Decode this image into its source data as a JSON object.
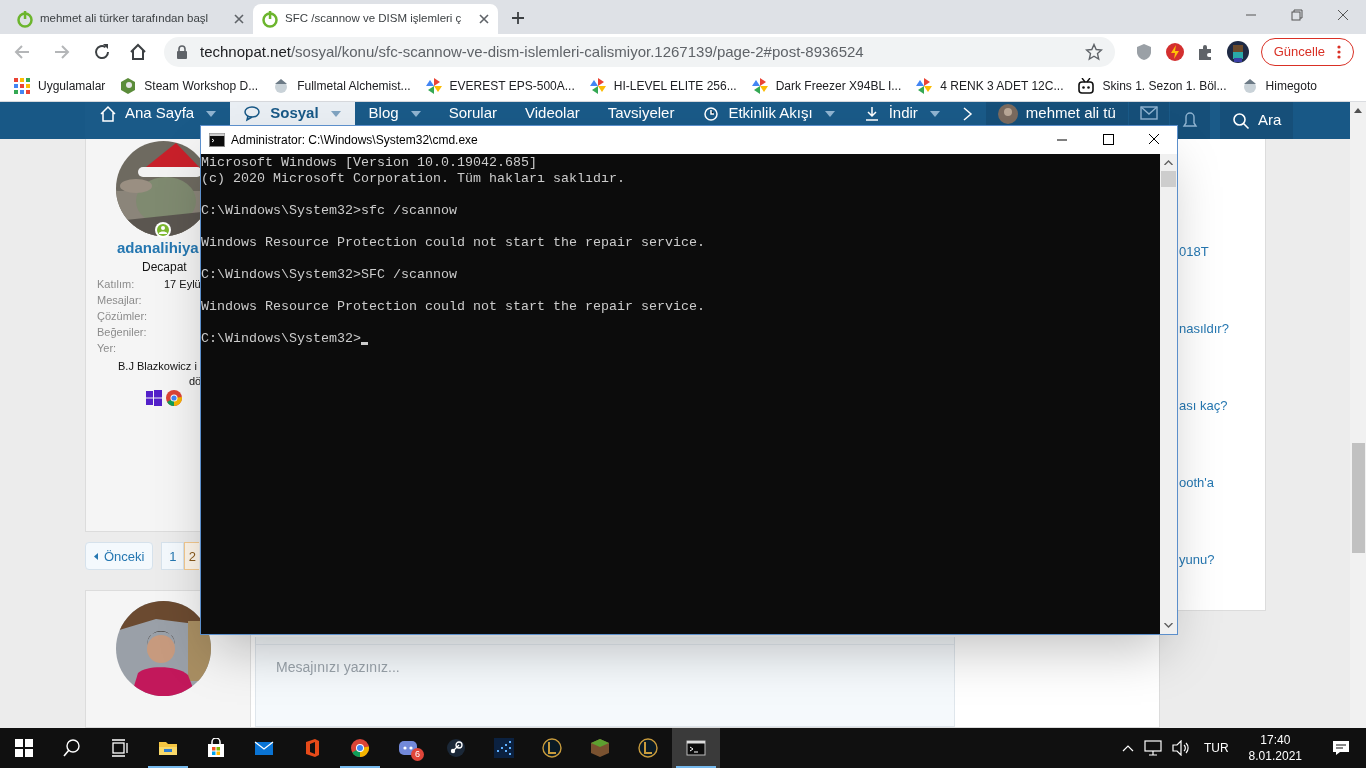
{
  "browser": {
    "tabs": [
      {
        "title": "mehmet ali türker tarafından başl",
        "selected": false
      },
      {
        "title": "SFC /scannow ve DISM işlemleri ç",
        "selected": true
      }
    ],
    "address": {
      "domain": "technopat.net",
      "path": "/sosyal/konu/sfc-scannow-ve-dism-islemleri-calismiyor.1267139/page-2#post-8936524"
    },
    "update_button": "Güncelle",
    "bookmarks": [
      {
        "label": "Uygulamalar",
        "kind": "apps"
      },
      {
        "label": "Steam Workshop D...",
        "kind": "steam"
      },
      {
        "label": "Fullmetal Alchemist...",
        "kind": "face"
      },
      {
        "label": "EVEREST EPS-500A...",
        "kind": "pinwheel"
      },
      {
        "label": "HI-LEVEL ELITE 256...",
        "kind": "pinwheel"
      },
      {
        "label": "Dark Freezer X94BL I...",
        "kind": "pinwheel"
      },
      {
        "label": "4 RENK 3 ADET 12C...",
        "kind": "pinwheel"
      },
      {
        "label": "Skins 1. Sezon 1. Böl...",
        "kind": "tv"
      },
      {
        "label": "Himegoto",
        "kind": "face"
      }
    ]
  },
  "site_nav": {
    "items": [
      {
        "label": "Ana Sayfa",
        "selected": false,
        "dropdown": true,
        "kind": "home"
      },
      {
        "label": "Sosyal",
        "selected": true,
        "dropdown": true,
        "kind": "chat"
      },
      {
        "label": "Blog",
        "selected": false,
        "dropdown": true,
        "kind": "none"
      },
      {
        "label": "Sorular",
        "selected": false,
        "dropdown": false,
        "kind": "none"
      },
      {
        "label": "Videolar",
        "selected": false,
        "dropdown": false,
        "kind": "none"
      },
      {
        "label": "Tavsiyeler",
        "selected": false,
        "dropdown": false,
        "kind": "none"
      },
      {
        "label": "Etkinlik Akışı",
        "selected": false,
        "dropdown": true,
        "kind": "activity"
      },
      {
        "label": "İndir",
        "selected": false,
        "dropdown": true,
        "kind": "download"
      }
    ],
    "user": "mehmet ali tü",
    "search": "Ara"
  },
  "post": {
    "username": "adanalihiya",
    "user_title": "Decapat",
    "stats": [
      {
        "label": "Katılım:",
        "value": "17 Eylü"
      },
      {
        "label": "Mesajlar:"
      },
      {
        "label": "Çözümler:"
      },
      {
        "label": "Beğeniler:"
      },
      {
        "label": "Yer:"
      }
    ],
    "location": [
      "B.J Blazkowicz i",
      "dö"
    ]
  },
  "pagination": {
    "prev": "Önceki",
    "pages": [
      {
        "label": "1",
        "selected": false
      },
      {
        "label": "2",
        "selected": true
      }
    ]
  },
  "reply": {
    "placeholder": "Mesajınızı yazınız..."
  },
  "sidebar_links": [
    "018T",
    "nasıldır?",
    "ası kaç?",
    "ooth'a",
    "yunu?"
  ],
  "console": {
    "title": "Administrator: C:\\Windows\\System32\\cmd.exe",
    "blocks": [
      [
        "Microsoft Windows [Version 10.0.19042.685]",
        "(c) 2020 Microsoft Corporation. Tüm hakları saklıdır."
      ],
      [
        "C:\\Windows\\System32>sfc /scannow"
      ],
      [
        "Windows Resource Protection could not start the repair service."
      ],
      [
        "C:\\Windows\\System32>SFC /scannow"
      ],
      [
        "Windows Resource Protection could not start the repair service."
      ],
      [
        "C:\\Windows\\System32>"
      ]
    ],
    "cursor": true
  },
  "taskbar": {
    "apps": [
      {
        "kind": "explorer",
        "running": true,
        "active": false
      },
      {
        "kind": "store",
        "running": false,
        "active": false
      },
      {
        "kind": "mail",
        "running": false,
        "active": false
      },
      {
        "kind": "office",
        "running": false,
        "active": false
      },
      {
        "kind": "chrome",
        "running": true,
        "active": false
      },
      {
        "kind": "discord",
        "running": false,
        "active": false,
        "badge": "6"
      },
      {
        "kind": "steam",
        "running": false,
        "active": false
      },
      {
        "kind": "grid",
        "running": false,
        "active": false
      },
      {
        "kind": "league",
        "running": false,
        "active": false
      },
      {
        "kind": "block",
        "running": false,
        "active": false
      },
      {
        "kind": "league",
        "running": false,
        "active": false
      },
      {
        "kind": "console",
        "running": true,
        "active": true
      }
    ],
    "language": "TUR",
    "time": "17:40",
    "date": "8.01.2021"
  }
}
